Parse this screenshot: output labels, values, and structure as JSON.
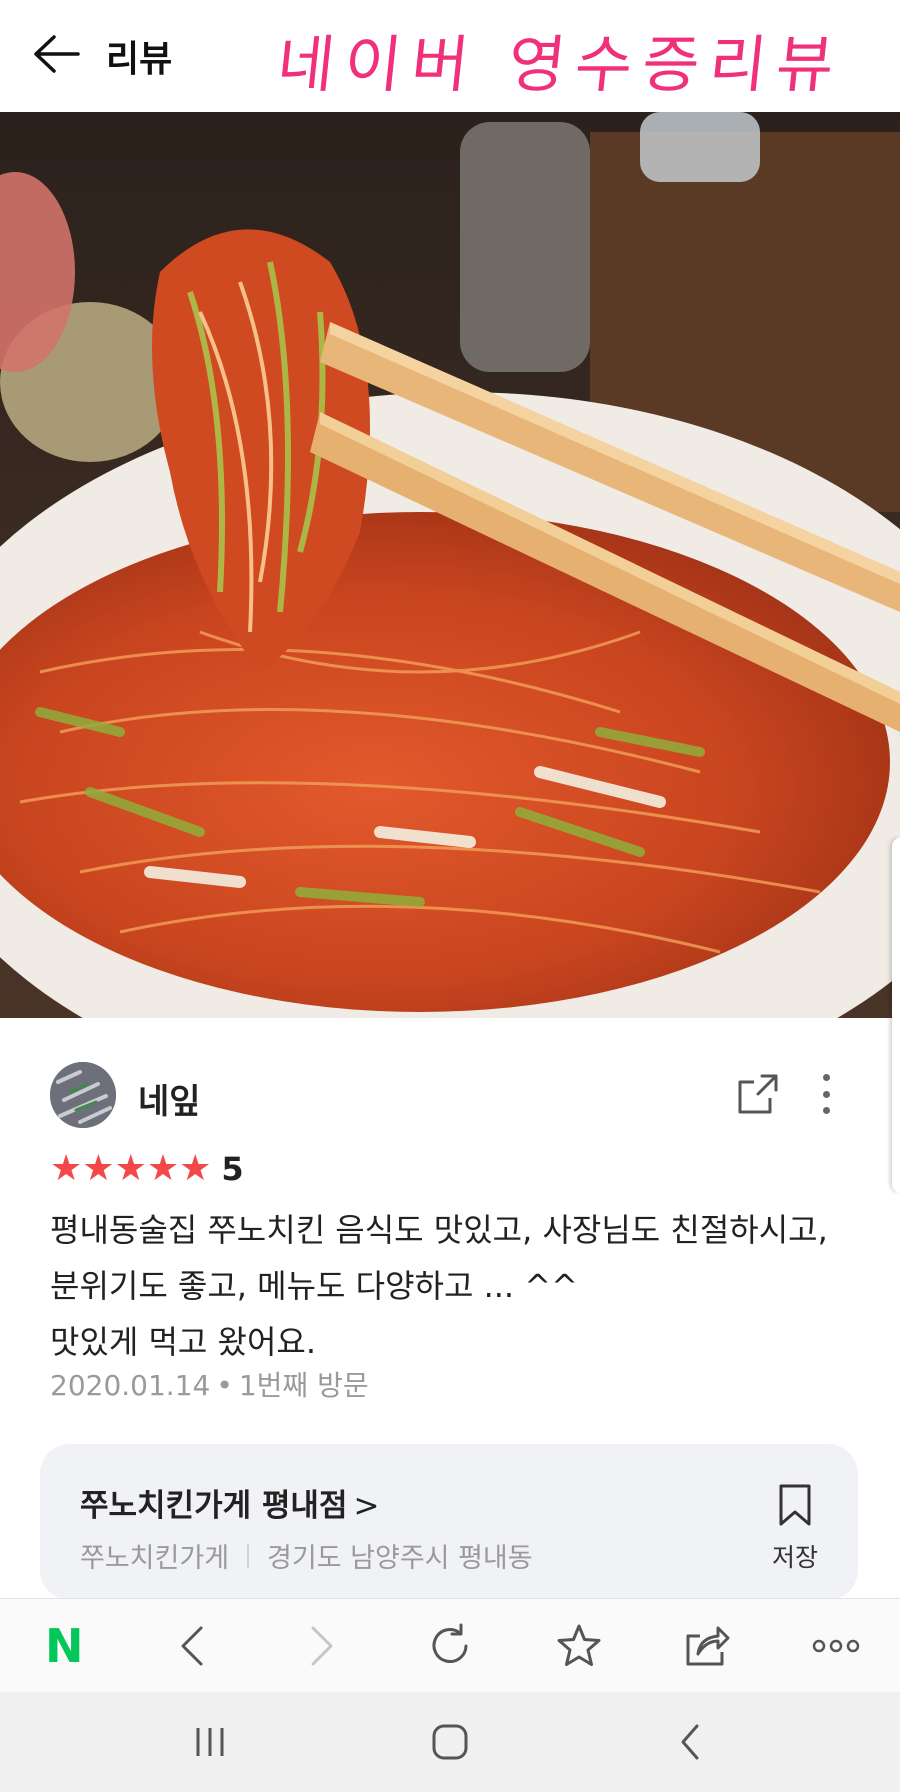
{
  "header": {
    "title": "리뷰",
    "overlay_caption": "네이버 영수증리뷰"
  },
  "review": {
    "username": "네잎",
    "rating_stars": 5,
    "rating_value": "5",
    "text": "평내동술집 쭈노치킨 음식도 맛있고, 사장님도 친절하시고,\n분위기도 좋고, 메뉴도 다양하고 ... ^^\n맛있게 먹고 왔어요.",
    "date": "2020.01.14",
    "dot": "•",
    "visit": "1번째 방문"
  },
  "store": {
    "name": "쭈노치킨가게 평내점",
    "chevron": ">",
    "category": "쭈노치킨가게",
    "address": "경기도 남양주시 평내동",
    "save_label": "저장"
  },
  "browser_toolbar": {
    "brand_letter": "N",
    "icons": [
      "naver-home-icon",
      "back-icon",
      "forward-icon",
      "refresh-icon",
      "bookmark-star-icon",
      "share-icon",
      "more-icon"
    ]
  },
  "system_nav": {
    "icons": [
      "recent-apps-icon",
      "home-icon",
      "system-back-icon"
    ]
  },
  "colors": {
    "caption_pink": "#f0307a",
    "star_red": "#f2484a",
    "naver_green": "#03c75a",
    "card_bg": "#f1f2f5"
  }
}
